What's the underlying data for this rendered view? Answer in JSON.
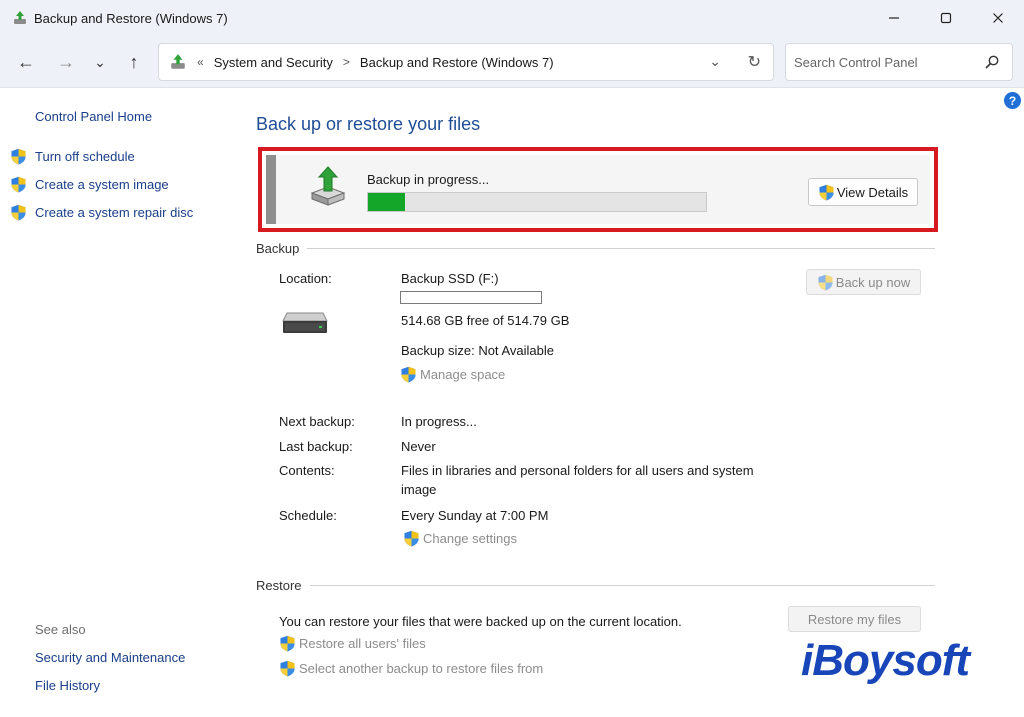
{
  "window": {
    "title": "Backup and Restore (Windows 7)",
    "controls": {
      "minimize": "—",
      "maximize": "☐",
      "close": "✕"
    }
  },
  "nav": {
    "back": "←",
    "forward": "→",
    "recent": "⌄",
    "up": "↑",
    "overflow": "«",
    "breadcrumb": [
      "System and Security",
      "Backup and Restore (Windows 7)"
    ],
    "breadcrumb_sep": ">",
    "dropdown": "⌄",
    "refresh": "↻",
    "search_placeholder": "Search Control Panel"
  },
  "help": "?",
  "left_pane": {
    "home": "Control Panel Home",
    "tasks": [
      "Turn off schedule",
      "Create a system image",
      "Create a system repair disc"
    ],
    "see_also": "See also",
    "see_also_links": [
      "Security and Maintenance",
      "File History"
    ]
  },
  "main": {
    "title": "Back up or restore your files",
    "progress": {
      "label": "Backup in progress...",
      "fraction": 0.11,
      "button": "View Details"
    },
    "backup": {
      "heading": "Backup",
      "location_label": "Location:",
      "location_value": "Backup SSD (F:)",
      "space_used_fraction": 0.0,
      "free_space": "514.68 GB free of 514.79 GB",
      "backup_size": "Backup size: Not Available",
      "manage_space": "Manage space",
      "back_up_now": "Back up now",
      "next_backup_label": "Next backup:",
      "next_backup_value": "In progress...",
      "last_backup_label": "Last backup:",
      "last_backup_value": "Never",
      "contents_label": "Contents:",
      "contents_value": "Files in libraries and personal folders for all users and system image",
      "schedule_label": "Schedule:",
      "schedule_value": "Every Sunday at 7:00 PM",
      "change_settings": "Change settings"
    },
    "restore": {
      "heading": "Restore",
      "description": "You can restore your files that were backed up on the current location.",
      "restore_all": "Restore all users' files",
      "select_another": "Select another backup to restore files from",
      "restore_button": "Restore my files"
    }
  },
  "watermark": "iBoysoft",
  "colors": {
    "accent_link": "#1a3e8a",
    "title_blue": "#1f4e96",
    "highlight_red": "#d71920",
    "progress_green": "#13a629",
    "disabled_text": "#8c8c8c"
  }
}
